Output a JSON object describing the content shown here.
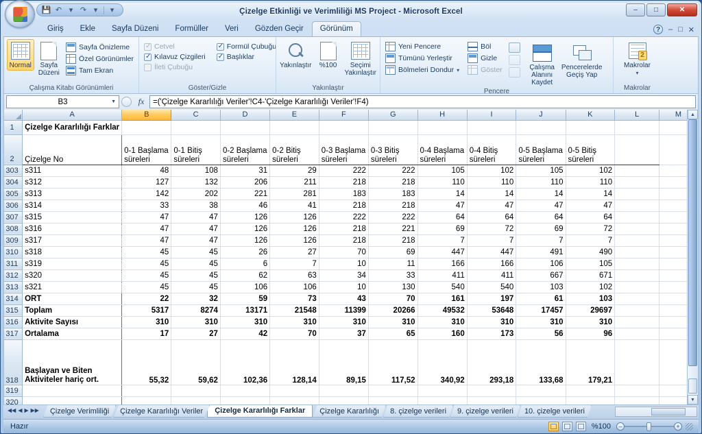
{
  "window": {
    "title": "Çizelge Etkinliği ve Verimliliği MS Project - Microsoft Excel",
    "minimize": "–",
    "maximize": "□",
    "close": "✕"
  },
  "qat": {
    "save_icon": "save-icon",
    "undo_icon": "undo-icon",
    "redo_icon": "redo-icon",
    "more_icon": "customize-icon"
  },
  "ribbon": {
    "tabs": [
      {
        "label": "Giriş",
        "active": false
      },
      {
        "label": "Ekle",
        "active": false
      },
      {
        "label": "Sayfa Düzeni",
        "active": false
      },
      {
        "label": "Formüller",
        "active": false
      },
      {
        "label": "Veri",
        "active": false
      },
      {
        "label": "Gözden Geçir",
        "active": false
      },
      {
        "label": "Görünüm",
        "active": true
      }
    ],
    "help": "?",
    "min": "–",
    "restore": "□",
    "close": "✕",
    "groups": [
      {
        "title": "Çalışma Kitabı Görünümleri",
        "big": [
          {
            "label": "Normal",
            "selected": true
          },
          {
            "label": "Sayfa Düzeni",
            "selected": false
          }
        ],
        "small": [
          {
            "label": "Sayfa Önizleme",
            "disabled": false
          },
          {
            "label": "Özel Görünümler",
            "disabled": false
          },
          {
            "label": "Tam Ekran",
            "disabled": false
          }
        ]
      },
      {
        "title": "Göster/Gizle",
        "checks_left": [
          {
            "label": "Cetvel",
            "checked": true,
            "disabled": true
          },
          {
            "label": "Kılavuz Çizgileri",
            "checked": true,
            "disabled": false
          },
          {
            "label": "İleti Çubuğu",
            "checked": false,
            "disabled": true
          }
        ],
        "checks_right": [
          {
            "label": "Formül Çubuğu",
            "checked": true,
            "disabled": false
          },
          {
            "label": "Başlıklar",
            "checked": true,
            "disabled": false
          }
        ]
      },
      {
        "title": "Yakınlaştır",
        "big": [
          {
            "label": "Yakınlaştır"
          },
          {
            "label": "%100"
          },
          {
            "label": "Seçimi Yakınlaştır"
          }
        ]
      },
      {
        "title": "Pencere",
        "small_left": [
          {
            "label": "Yeni Pencere",
            "disabled": false
          },
          {
            "label": "Tümünü Yerleştir",
            "disabled": false
          },
          {
            "label": "Bölmeleri Dondur",
            "disabled": false,
            "dropdown": true
          }
        ],
        "small_right": [
          {
            "label": "Böl",
            "disabled": false
          },
          {
            "label": "Gizle",
            "disabled": false
          },
          {
            "label": "Göster",
            "disabled": true
          }
        ],
        "big": [
          {
            "label": "Çalışma Alanını Kaydet"
          },
          {
            "label": "Pencerelerde Geçiş Yap",
            "dropdown": true
          }
        ]
      },
      {
        "title": "Makrolar",
        "big": [
          {
            "label": "Makrolar",
            "dropdown": true
          }
        ]
      }
    ]
  },
  "formula_bar": {
    "name_box": "B3",
    "fx": "fx",
    "formula": "=('Çizelge Kararlılığı Veriler'!C4-'Çizelge Kararlılığı Veriler'!F4)"
  },
  "grid": {
    "columns": [
      "A",
      "B",
      "C",
      "D",
      "E",
      "F",
      "G",
      "H",
      "I",
      "J",
      "K",
      "L",
      "M"
    ],
    "selected_column": "B",
    "title_row": {
      "row": "1",
      "text": "Çizelge Kararlılığı Farklar"
    },
    "header_row": {
      "row": "2",
      "cells": [
        "Çizelge No",
        "0-1 Başlama süreleri",
        "0-1 Bitiş süreleri",
        "0-2 Başlama süreleri",
        "0-2 Bitiş süreleri",
        "0-3 Başlama süreleri",
        "0-3 Bitiş süreleri",
        "0-4 Başlama süreleri",
        "0-4 Bitiş süreleri",
        "0-5 Başlama süreleri",
        "0-5 Bitiş süreleri",
        "",
        ""
      ]
    },
    "rows": [
      {
        "row": "303",
        "label": "s311",
        "bold": false,
        "values": [
          "48",
          "108",
          "31",
          "29",
          "222",
          "222",
          "105",
          "102",
          "105",
          "102"
        ]
      },
      {
        "row": "304",
        "label": "s312",
        "bold": false,
        "values": [
          "127",
          "132",
          "206",
          "211",
          "218",
          "218",
          "110",
          "110",
          "110",
          "110"
        ]
      },
      {
        "row": "305",
        "label": "s313",
        "bold": false,
        "values": [
          "142",
          "202",
          "221",
          "281",
          "183",
          "183",
          "14",
          "14",
          "14",
          "14"
        ]
      },
      {
        "row": "306",
        "label": "s314",
        "bold": false,
        "values": [
          "33",
          "38",
          "46",
          "41",
          "218",
          "218",
          "47",
          "47",
          "47",
          "47"
        ]
      },
      {
        "row": "307",
        "label": "s315",
        "bold": false,
        "values": [
          "47",
          "47",
          "126",
          "126",
          "222",
          "222",
          "64",
          "64",
          "64",
          "64"
        ]
      },
      {
        "row": "308",
        "label": "s316",
        "bold": false,
        "values": [
          "47",
          "47",
          "126",
          "126",
          "218",
          "221",
          "69",
          "72",
          "69",
          "72"
        ]
      },
      {
        "row": "309",
        "label": "s317",
        "bold": false,
        "values": [
          "47",
          "47",
          "126",
          "126",
          "218",
          "218",
          "7",
          "7",
          "7",
          "7"
        ]
      },
      {
        "row": "310",
        "label": "s318",
        "bold": false,
        "values": [
          "45",
          "45",
          "26",
          "27",
          "70",
          "69",
          "447",
          "447",
          "491",
          "490"
        ]
      },
      {
        "row": "311",
        "label": "s319",
        "bold": false,
        "values": [
          "45",
          "45",
          "6",
          "7",
          "10",
          "11",
          "166",
          "166",
          "106",
          "105"
        ]
      },
      {
        "row": "312",
        "label": "s320",
        "bold": false,
        "values": [
          "45",
          "45",
          "62",
          "63",
          "34",
          "33",
          "411",
          "411",
          "667",
          "671"
        ]
      },
      {
        "row": "313",
        "label": "s321",
        "bold": false,
        "values": [
          "45",
          "45",
          "106",
          "106",
          "10",
          "130",
          "540",
          "540",
          "103",
          "102"
        ]
      },
      {
        "row": "314",
        "label": "ORT",
        "bold": true,
        "values": [
          "22",
          "32",
          "59",
          "73",
          "43",
          "70",
          "161",
          "197",
          "61",
          "103"
        ]
      },
      {
        "row": "315",
        "label": "Toplam",
        "bold": true,
        "values": [
          "5317",
          "8274",
          "13171",
          "21548",
          "11399",
          "20266",
          "49532",
          "53648",
          "17457",
          "29697"
        ]
      },
      {
        "row": "316",
        "label": "Aktivite Sayısı",
        "bold": true,
        "values": [
          "310",
          "310",
          "310",
          "310",
          "310",
          "310",
          "310",
          "310",
          "310",
          "310"
        ]
      },
      {
        "row": "317",
        "label": "Ortalama",
        "bold": true,
        "values": [
          "17",
          "27",
          "42",
          "70",
          "37",
          "65",
          "160",
          "173",
          "56",
          "96"
        ]
      },
      {
        "row": "318",
        "label": "Başlayan ve Biten Aktiviteler hariç ort.",
        "bold": true,
        "values": [
          "55,32",
          "59,62",
          "102,36",
          "128,14",
          "89,15",
          "117,52",
          "340,92",
          "293,18",
          "133,68",
          "179,21"
        ]
      },
      {
        "row": "319",
        "label": "",
        "bold": false,
        "values": [
          "",
          "",
          "",
          "",
          "",
          "",
          "",
          "",
          "",
          ""
        ]
      },
      {
        "row": "320",
        "label": "",
        "bold": false,
        "values": [
          "",
          "",
          "",
          "",
          "",
          "",
          "",
          "",
          "",
          ""
        ]
      }
    ]
  },
  "sheet_tabs": {
    "nav": {
      "first": "◀◀",
      "prev": "◀",
      "next": "▶",
      "last": "▶▶"
    },
    "tabs": [
      {
        "label": "Çizelge Verimliliği",
        "active": false
      },
      {
        "label": "Çizelge Kararlılığı Veriler",
        "active": false
      },
      {
        "label": "Çizelge Kararlılığı Farklar",
        "active": true
      },
      {
        "label": "Çizelge Kararlılığı",
        "active": false
      },
      {
        "label": "8. çizelge verileri",
        "active": false
      },
      {
        "label": "9. çizelge verileri",
        "active": false
      },
      {
        "label": "10. çizelge verileri",
        "active": false
      }
    ]
  },
  "status_bar": {
    "ready": "Hazır",
    "views": [
      "normal-view-icon",
      "page-layout-icon",
      "page-break-icon"
    ],
    "zoom": "%100",
    "zoom_out": "–",
    "zoom_in": "+"
  }
}
